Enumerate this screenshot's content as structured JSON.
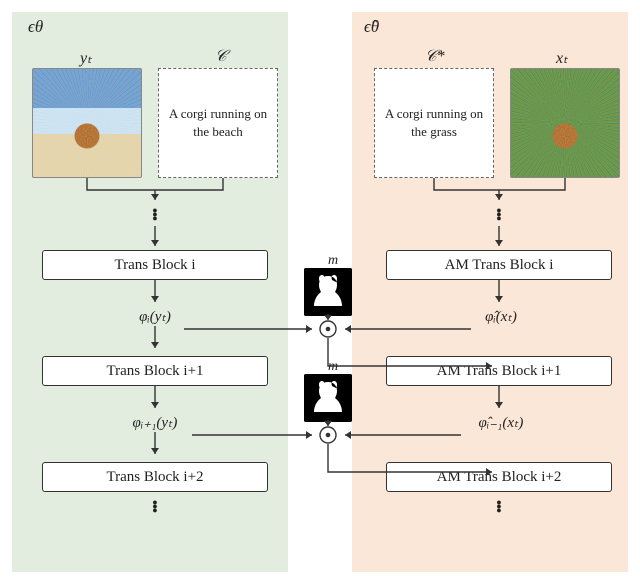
{
  "left": {
    "model": "ϵθ",
    "y_label": "yₜ",
    "c_label": "𝒞",
    "prompt": "A corgi running on the beach",
    "block1": "Trans Block i",
    "block2": "Trans Block i+1",
    "block3": "Trans Block i+2",
    "phi1": "φᵢ(yₜ)",
    "phi2": "φᵢ₊₁(yₜ)"
  },
  "right": {
    "model": "ϵ̂θ",
    "x_label": "xₜ",
    "c_label": "𝒞*",
    "prompt": "A corgi running on the grass",
    "block1": "AM Trans Block  i",
    "block2": "AM Trans Block  i+1",
    "block3": "AM Trans Block  i+2",
    "phi1": "φ̂ᵢ(xₜ)",
    "phi2": "φ̂ᵢ₋₁(xₜ)"
  },
  "mask_label": "m"
}
